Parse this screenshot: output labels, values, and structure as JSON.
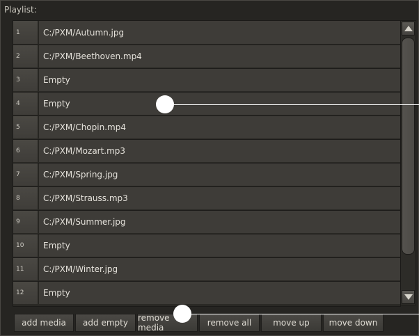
{
  "panel": {
    "title": "Playlist:"
  },
  "playlist": {
    "items": [
      {
        "num": "1",
        "name": "C:/PXM/Autumn.jpg"
      },
      {
        "num": "2",
        "name": "C:/PXM/Beethoven.mp4"
      },
      {
        "num": "3",
        "name": "Empty"
      },
      {
        "num": "4",
        "name": "Empty"
      },
      {
        "num": "5",
        "name": "C:/PXM/Chopin.mp4"
      },
      {
        "num": "6",
        "name": "C:/PXM/Mozart.mp3"
      },
      {
        "num": "7",
        "name": "C:/PXM/Spring.jpg"
      },
      {
        "num": "8",
        "name": "C:/PXM/Strauss.mp3"
      },
      {
        "num": "9",
        "name": "C:/PXM/Summer.jpg"
      },
      {
        "num": "10",
        "name": "Empty"
      },
      {
        "num": "11",
        "name": "C:/PXM/Winter.jpg"
      },
      {
        "num": "12",
        "name": "Empty"
      }
    ]
  },
  "scrollbar": {
    "up_icon": "triangle-up-icon",
    "down_icon": "triangle-down-icon"
  },
  "buttons": {
    "add_media": "add media",
    "add_empty": "add empty",
    "remove_media": "remove media",
    "remove_all": "remove all",
    "move_up": "move up",
    "move_down": "move down"
  },
  "colors": {
    "panel_bg": "#262522",
    "row_bg": "#3e3c38",
    "text": "#e4e1da",
    "annotation": "#ffffff"
  }
}
